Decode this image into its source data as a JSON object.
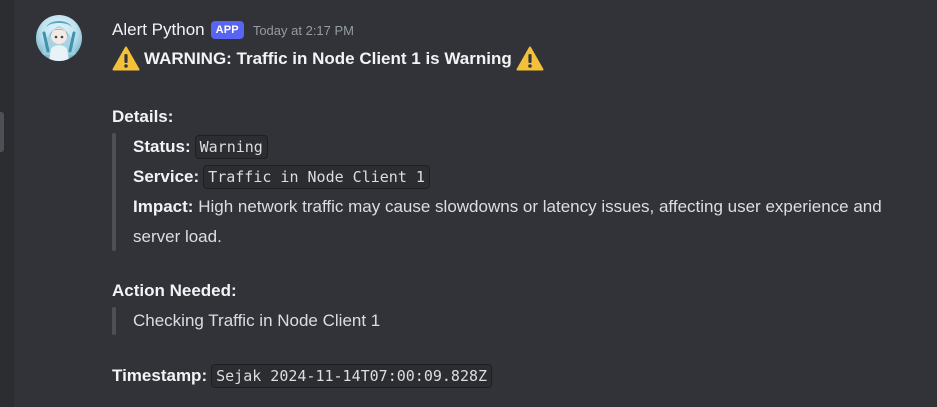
{
  "message": {
    "username": "Alert Python",
    "badge": "APP",
    "time": "Today at 2:17 PM",
    "title": "WARNING: Traffic in Node Client 1 is Warning",
    "title_icon": "warning-emoji",
    "details": {
      "label": "Details:",
      "status_key": "Status:",
      "status_value": "Warning",
      "service_key": "Service:",
      "service_value": "Traffic in Node Client 1",
      "impact_key": "Impact:",
      "impact_value": "High network traffic may cause slowdowns or latency issues, affecting user experience and server load."
    },
    "action": {
      "label": "Action Needed:",
      "value": "Checking Traffic in Node Client 1"
    },
    "timestamp": {
      "label": "Timestamp:",
      "value": "Sejak 2024-11-14T07:00:09.828Z"
    }
  },
  "colors": {
    "background": "#313338",
    "badge": "#5865f2",
    "quote_bar": "#4e5058",
    "muted_text": "#949ba4",
    "warning": "#f4c03a"
  }
}
